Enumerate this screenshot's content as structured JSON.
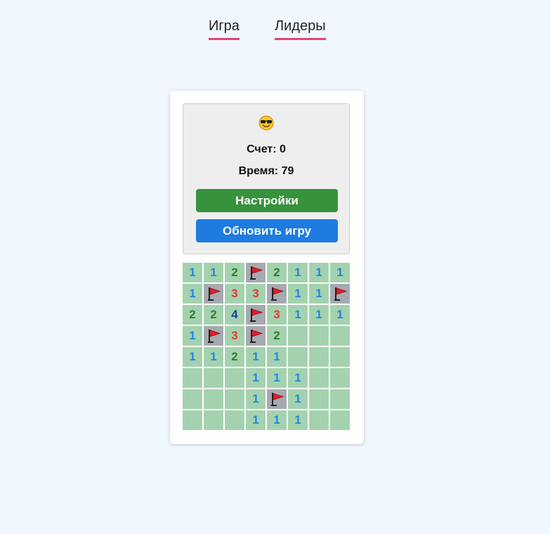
{
  "nav": {
    "tabs": [
      {
        "label": "Игра",
        "active": true
      },
      {
        "label": "Лидеры",
        "active": false
      }
    ],
    "underline_color": "#e0456e"
  },
  "status": {
    "face_icon": "sunglasses-face-icon",
    "score_label": "Счет: 0",
    "time_label": "Время: 79"
  },
  "buttons": {
    "settings_label": "Настройки",
    "restart_label": "Обновить игру"
  },
  "colors": {
    "page_bg": "#f0f7ff",
    "revealed_cell": "#a4d2ae",
    "flag_cell": "#a6aab0",
    "settings_button": "#36923c",
    "restart_button": "#1e7be0",
    "number_1": "#1e88e5",
    "number_2": "#2e7d32",
    "number_3": "#e53935",
    "number_4": "#0d47a1"
  },
  "board": {
    "rows": 8,
    "cols": 8,
    "cells": [
      [
        "1",
        "1",
        "2",
        "F",
        "2",
        "1",
        "1",
        "1"
      ],
      [
        "1",
        "F",
        "3",
        "3",
        "F",
        "1",
        "1",
        "F"
      ],
      [
        "2",
        "2",
        "4",
        "F",
        "3",
        "1",
        "1",
        "1"
      ],
      [
        "1",
        "F",
        "3",
        "F",
        "2",
        "",
        "",
        ""
      ],
      [
        "1",
        "1",
        "2",
        "1",
        "1",
        "",
        "",
        ""
      ],
      [
        "",
        "",
        "",
        "1",
        "1",
        "1",
        "",
        ""
      ],
      [
        "",
        "",
        "",
        "1",
        "F",
        "1",
        "",
        ""
      ],
      [
        "",
        "",
        "",
        "1",
        "1",
        "1",
        "",
        ""
      ]
    ]
  }
}
